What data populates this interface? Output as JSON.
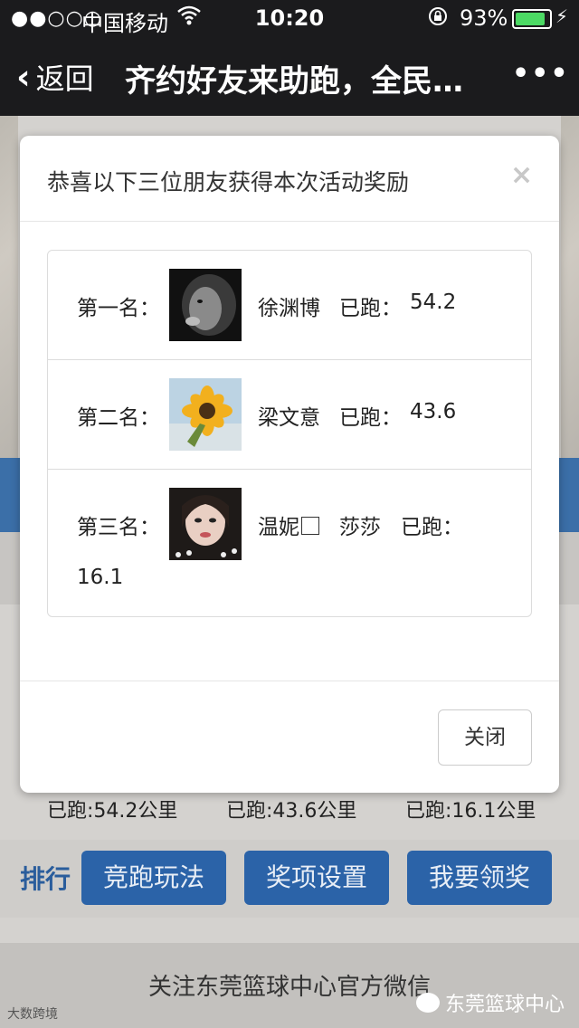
{
  "status_bar": {
    "signal": "●●○○○",
    "carrier": "中国移动",
    "time": "10:20",
    "battery_percent": "93%",
    "battery_level": 0.93
  },
  "nav": {
    "back_label": "返回",
    "title": "齐约好友来助跑，全民…",
    "more": "•••"
  },
  "modal": {
    "title": "恭喜以下三位朋友获得本次活动奖励",
    "close_x": "×",
    "winners": [
      {
        "rank": "第一名：",
        "name": "徐渊博",
        "run_label": "已跑：",
        "distance": "54.2"
      },
      {
        "rank": "第二名：",
        "name": "梁文意",
        "run_label": "已跑：",
        "distance": "43.6"
      },
      {
        "rank": "第三名：",
        "name": "温妮",
        "name_suffix": "莎莎",
        "run_label": "已跑：",
        "distance": "16.1"
      }
    ],
    "close_button": "关闭"
  },
  "background": {
    "stats": [
      "已跑:54.2公里",
      "已跑:43.6公里",
      "已跑:16.1公里"
    ],
    "rank_tab": "排行",
    "buttons": [
      "竞跑玩法",
      "奖项设置",
      "我要领奖"
    ],
    "follow_text": "关注东莞篮球中心官方微信",
    "watermark_left": "大数跨境",
    "watermark_right": "东莞篮球中心"
  },
  "colors": {
    "bar_dark": "#1b1b1d",
    "accent_blue": "#2b63a8",
    "battery_green": "#4cd964"
  }
}
